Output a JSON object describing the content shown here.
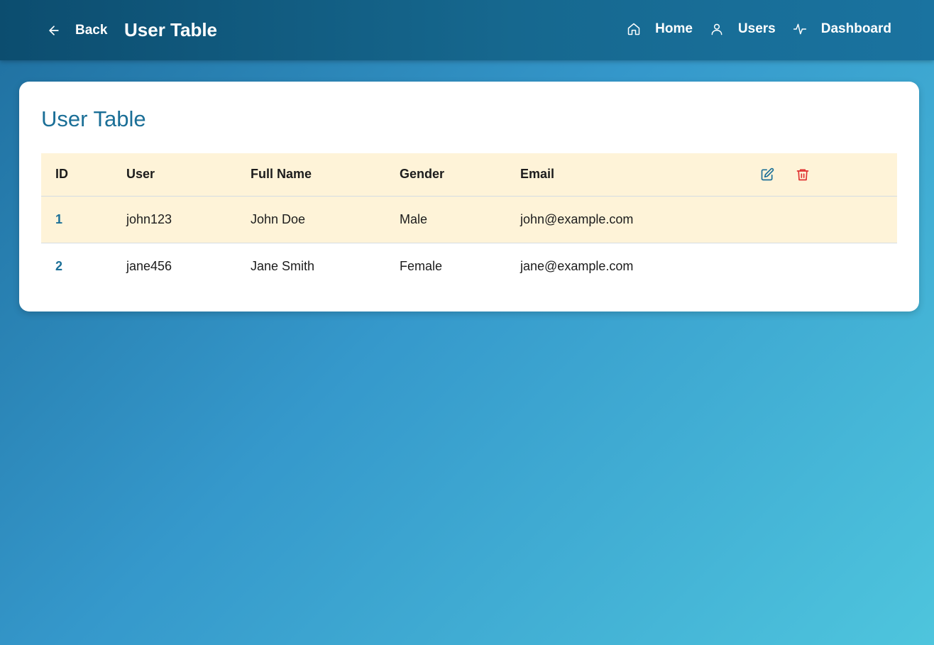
{
  "header": {
    "back_label": "Back",
    "title": "User Table",
    "nav": [
      {
        "label": "Home",
        "icon": "home-icon"
      },
      {
        "label": "Users",
        "icon": "user-icon"
      },
      {
        "label": "Dashboard",
        "icon": "activity-icon"
      }
    ]
  },
  "card": {
    "title": "User Table",
    "columns": {
      "id": "ID",
      "user": "User",
      "full_name": "Full Name",
      "gender": "Gender",
      "email": "Email"
    },
    "action_icons": [
      "edit-icon",
      "delete-icon"
    ],
    "rows": [
      {
        "id": "1",
        "user": "john123",
        "full_name": "John Doe",
        "gender": "Male",
        "email": "john@example.com"
      },
      {
        "id": "2",
        "user": "jane456",
        "full_name": "Jane Smith",
        "gender": "Female",
        "email": "jane@example.com"
      }
    ]
  },
  "colors": {
    "accent": "#1b6f97",
    "header_row_bg": "#fef3d8",
    "delete_red": "#e03131",
    "topbar_start": "#0c4d6f"
  }
}
